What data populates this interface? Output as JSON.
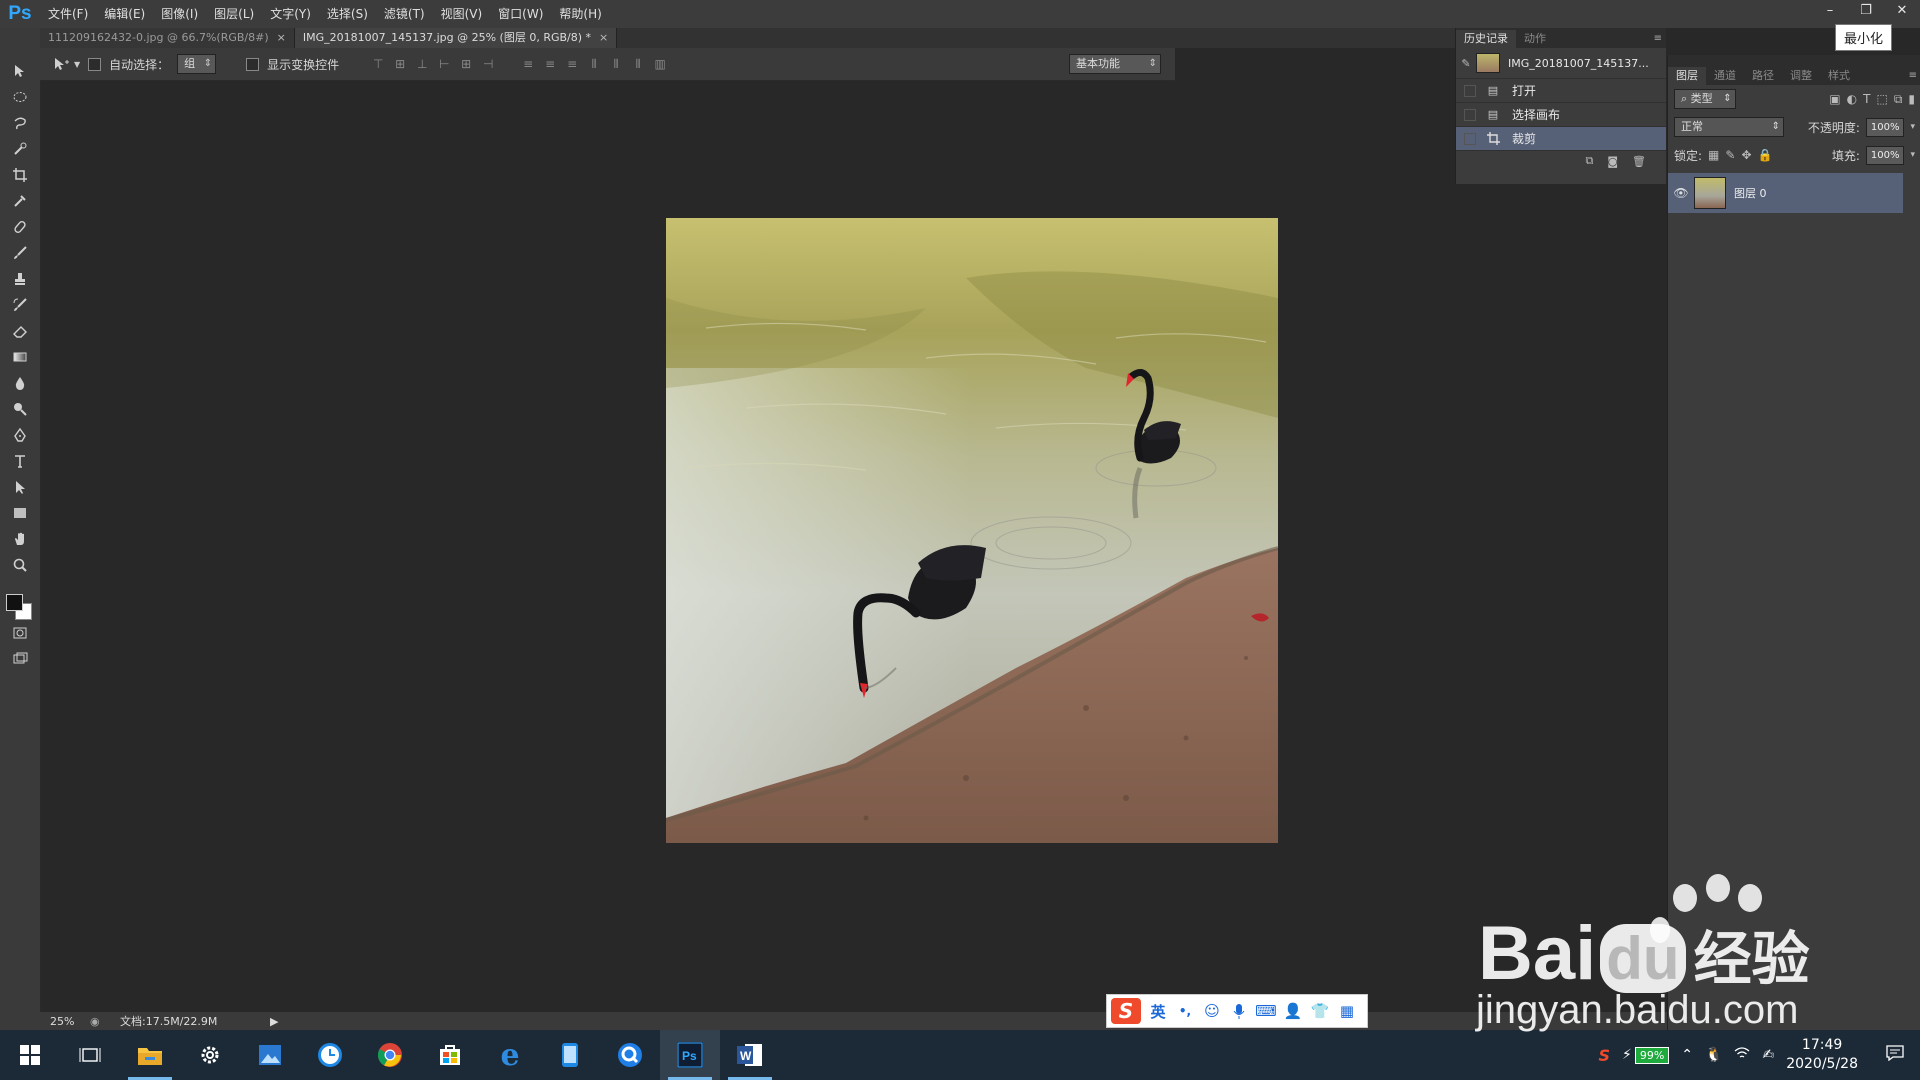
{
  "app": {
    "logo": "Ps",
    "menu": [
      "文件(F)",
      "编辑(E)",
      "图像(I)",
      "图层(L)",
      "文字(Y)",
      "选择(S)",
      "滤镜(T)",
      "视图(V)",
      "窗口(W)",
      "帮助(H)"
    ],
    "tooltip": "最小化"
  },
  "tabs": [
    {
      "label": "111209162432-0.jpg @ 66.7%(RGB/8#)",
      "close": "×"
    },
    {
      "label": "IMG_20181007_145137.jpg @ 25% (图层 0, RGB/8) *",
      "close": "×"
    }
  ],
  "options": {
    "auto_select_label": "自动选择：",
    "auto_select_value": "组",
    "show_transform_label": "显示变换控件",
    "workspace": "基本功能"
  },
  "history": {
    "tabs": [
      "历史记录",
      "动作"
    ],
    "snapshot": "IMG_20181007_145137...",
    "items": [
      "打开",
      "选择画布",
      "裁剪"
    ]
  },
  "layers": {
    "tabs": [
      "图层",
      "通道",
      "路径",
      "调整",
      "样式"
    ],
    "filter_kind": "类型",
    "blend_mode": "正常",
    "opacity_label": "不透明度:",
    "opacity_value": "100%",
    "lock_label": "锁定:",
    "fill_label": "填充:",
    "fill_value": "100%",
    "layer_name": "图层 0"
  },
  "status": {
    "zoom": "25%",
    "doc": "文档:17.5M/22.9M"
  },
  "ime": {
    "lang": "英",
    "punct": "•,"
  },
  "taskbar": {
    "battery": "99%",
    "time": "17:49",
    "date": "2020/5/28"
  },
  "watermark": {
    "brand": "Bai",
    "brand2": "du",
    "cn": "经验",
    "url": "jingyan.baidu.com"
  },
  "colors": {
    "accent_blue": "#31a8ff",
    "selection": "#566178",
    "panel": "#3c3c3c",
    "canvas_bg": "#282828"
  }
}
